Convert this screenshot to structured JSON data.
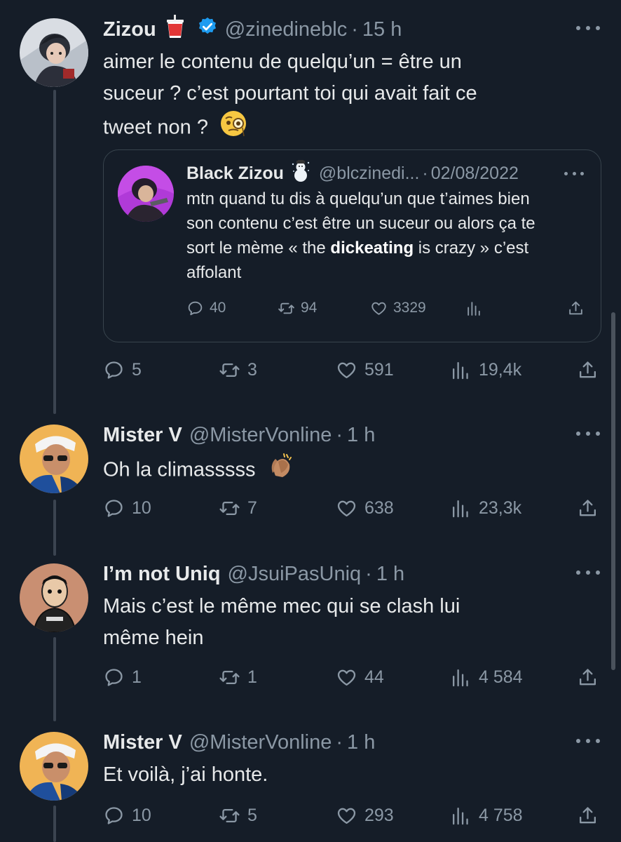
{
  "tweets": [
    {
      "name": "Zizou",
      "name_emoji": "drink-cup-icon",
      "verified": true,
      "handle": "@zinedineblc",
      "time": "15 h",
      "lines": [
        "aimer le contenu de quelqu’un = être un",
        "suceur ? c’est pourtant toi qui avait fait ce",
        "tweet non ?"
      ],
      "trailing_emoji": "monocle-face-icon",
      "quote": {
        "name": "Black Zizou",
        "name_emoji": "snowman-icon",
        "handle": "@blczinedi...",
        "date": "02/08/2022",
        "lines": [
          "mtn quand tu dis à quelqu’un que t’aimes bien",
          "son contenu c’est être un suceur ou alors ça te"
        ],
        "line3_before": "sort le mème « the ",
        "line3_bold": "dickeating",
        "line3_after": " is crazy » c’est",
        "line4": "affolant",
        "replies": "40",
        "retweets": "94",
        "likes": "3329"
      },
      "replies": "5",
      "retweets": "3",
      "likes": "591",
      "views": "19,4k"
    },
    {
      "name": "Mister V",
      "handle": "@MisterVonline",
      "time": "1 h",
      "lines": [
        "Oh la climasssss"
      ],
      "trailing_emoji": "clapping-hands-icon",
      "replies": "10",
      "retweets": "7",
      "likes": "638",
      "views": "23,3k"
    },
    {
      "name": "I’m not Uniq",
      "handle": "@JsuiPasUniq",
      "time": "1 h",
      "lines": [
        "Mais c’est le même mec qui se clash lui",
        "même hein"
      ],
      "replies": "1",
      "retweets": "1",
      "likes": "44",
      "views": "4 584"
    },
    {
      "name": "Mister V",
      "handle": "@MisterVonline",
      "time": "1 h",
      "lines": [
        "Et voilà, j’ai honte."
      ],
      "replies": "10",
      "retweets": "5",
      "likes": "293",
      "views": "4 758"
    }
  ],
  "colors": {
    "background": "#151d28",
    "text": "#e7e9ea",
    "muted": "#8b98a5",
    "verified": "#1d9bf0",
    "thread_line": "#3b4450"
  }
}
